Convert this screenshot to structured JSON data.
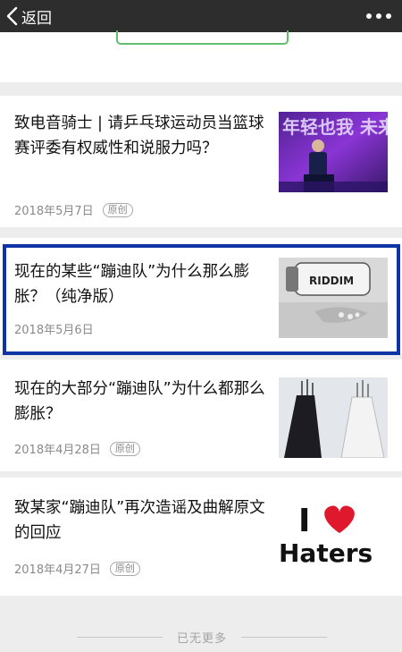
{
  "header": {
    "back_label": "返回"
  },
  "articles": [
    {
      "title": "致电音骑士 | 请乒乓球运动员当篮球赛评委有权威性和说服力吗？",
      "date": "2018年5月7日",
      "badge": "原创",
      "thumb_text": "年轻也我 未来中"
    },
    {
      "title": "现在的某些“蹦迪队”为什么那么膨胀？（纯净版）",
      "date": "2018年5月6日",
      "badge": "",
      "thumb_text": "RIDDIM"
    },
    {
      "title": "现在的大部分“蹦迪队”为什么都那么膨胀？",
      "date": "2018年4月28日",
      "badge": "原创",
      "thumb_text": ""
    },
    {
      "title": "致某家“蹦迪队”再次造谣及曲解原文的回应",
      "date": "2018年4月27日",
      "badge": "原创",
      "thumb_text": "Haters"
    }
  ],
  "footer": {
    "text": "已无更多"
  },
  "colors": {
    "highlight": "#0f34a5",
    "topbar": "#2d2d2d",
    "accent_green": "#61bd6d"
  }
}
